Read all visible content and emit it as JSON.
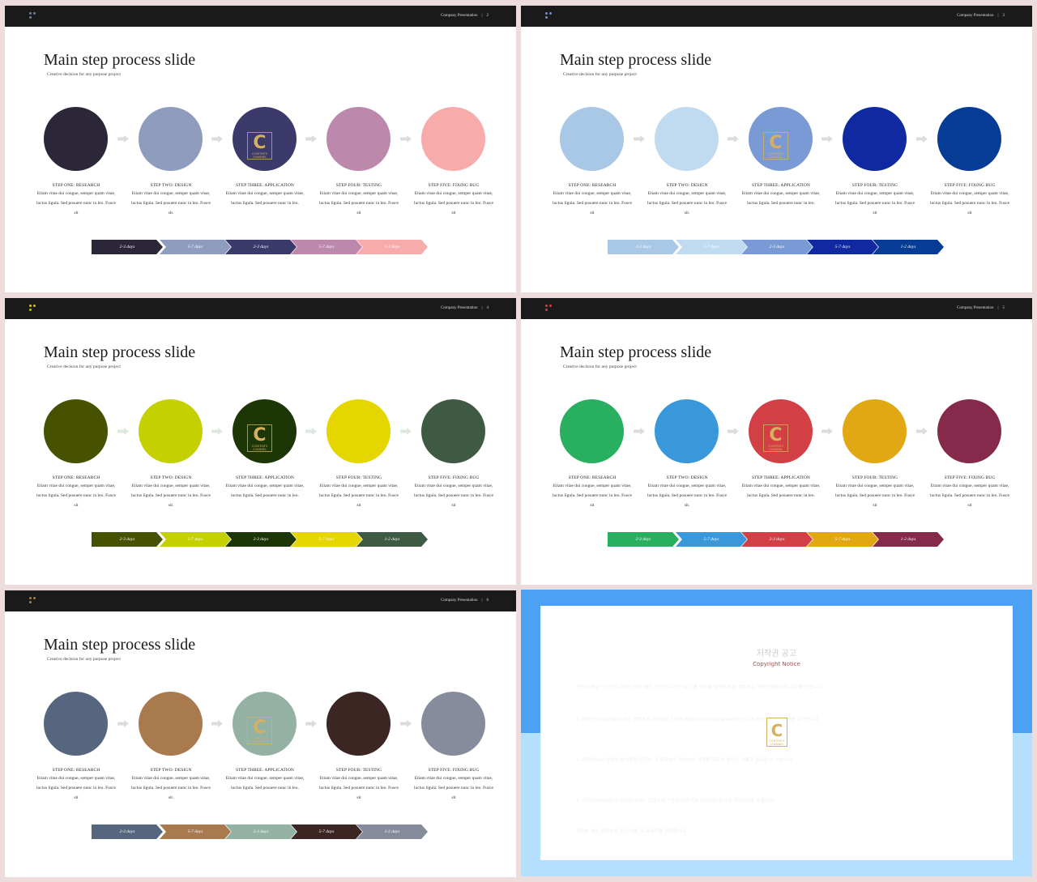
{
  "header": {
    "company": "Company Presentation",
    "separator": "|"
  },
  "slide_content": {
    "title": "Main step process slide",
    "subtitle": "Creative decision for any purpose  project",
    "steps": [
      {
        "title": "STEP ONE: RESEARCH",
        "desc": "Etiam vitae dui congue, semper quam vitae, luctus ligula. Sed posuere nunc in leo. Fusce sit"
      },
      {
        "title": "STEP TWO: DESIGN",
        "desc": "Etiam vitae dui congue, semper quam vitae, luctus ligula. Sed posuere nunc in leo. Fusce sit."
      },
      {
        "title": "STEP THREE: APPLICATION",
        "desc": "Etiam vitae dui congue, semper quam vitae, luctus ligula. Sed posuere nunc in leo."
      },
      {
        "title": "STEP FOUR: TESTING",
        "desc": "Etiam vitae dui congue, semper quam vitae, luctus ligula. Sed posuere nunc in leo. Fusce sit"
      },
      {
        "title": "STEP FIVE: FIXING BUG",
        "desc": "Etiam vitae dui congue, semper quam vitae, luctus ligula. Sed posuere nunc in leo. Fusce sit"
      }
    ],
    "durations": [
      "2-3 days",
      "5-7 days",
      "2-3 days",
      "5-7 days",
      "1-2 days"
    ]
  },
  "logo": {
    "letter": "C",
    "line1": "CONTENTS",
    "line2": "CHANNEL"
  },
  "slides": [
    {
      "page": "2",
      "colors": [
        "#2b2638",
        "#8e9cbe",
        "#3c3a6a",
        "#bc88ac",
        "#f7acab"
      ],
      "arrow_color": "#dcdcdc",
      "dot_colors": [
        "#6e7e9c",
        "#6e7e9c",
        "#6e7e9c"
      ]
    },
    {
      "page": "3",
      "colors": [
        "#a8c8e6",
        "#c0daf0",
        "#7a9ad6",
        "#1028a0",
        "#063c96"
      ],
      "arrow_color": "#dcdcdc",
      "dot_colors": [
        "#6e8ec8",
        "#6e8ec8",
        "#6e8ec8"
      ]
    },
    {
      "page": "4",
      "colors": [
        "#475200",
        "#c4d000",
        "#1c3606",
        "#e6d600",
        "#3e5a42"
      ],
      "arrow_color": "#dde8de",
      "dot_colors": [
        "#d4c400",
        "#d4c400",
        "#b2c400"
      ]
    },
    {
      "page": "5",
      "colors": [
        "#28b060",
        "#3898da",
        "#d24046",
        "#e2a814",
        "#862a4c"
      ],
      "arrow_color": "#dcdcdc",
      "dot_colors": [
        "#d24046",
        "#d24046",
        "#d24046"
      ]
    },
    {
      "page": "6",
      "colors": [
        "#56667e",
        "#a87a4e",
        "#94b2a4",
        "#3c2624",
        "#868c9c"
      ],
      "arrow_color": "#dcdcdc",
      "dot_colors": [
        "#a87a4e",
        "#a87a4e",
        "#a87a4e"
      ]
    }
  ],
  "copyright": {
    "title_kr": "저작권 공고",
    "title_en": "Copyright Notice",
    "paragraphs": [
      "컨텐츠 채널 스크립트 서비스 약관 제작 가능한 디자인 및 이용 방식을 설명하며 본 콘텐츠는 저작권법에 따라 보호를 받습니다.",
      "1. 저작권(Copyright) 모든 콘텐츠의 저작권은 컨텐츠채널(Contentschannel)에 있으며 무단 사용 및 배포를 금지합니다.",
      "2. 폰트(Font) 콘텐츠에 사용된 폰트는 각 제작사의 라이선스 정책을 따르며 별도의 구매가 필요할 수 있습니다.",
      "3. 이미지(Image) & 아이콘(Icon) 콘텐츠에 사용된 이미지와 아이콘은 출처의 라이선스를 따릅니다.",
      "컨텐츠 채널 콘텐츠의 무단 사용 및 재배포를 금지합니다."
    ]
  }
}
